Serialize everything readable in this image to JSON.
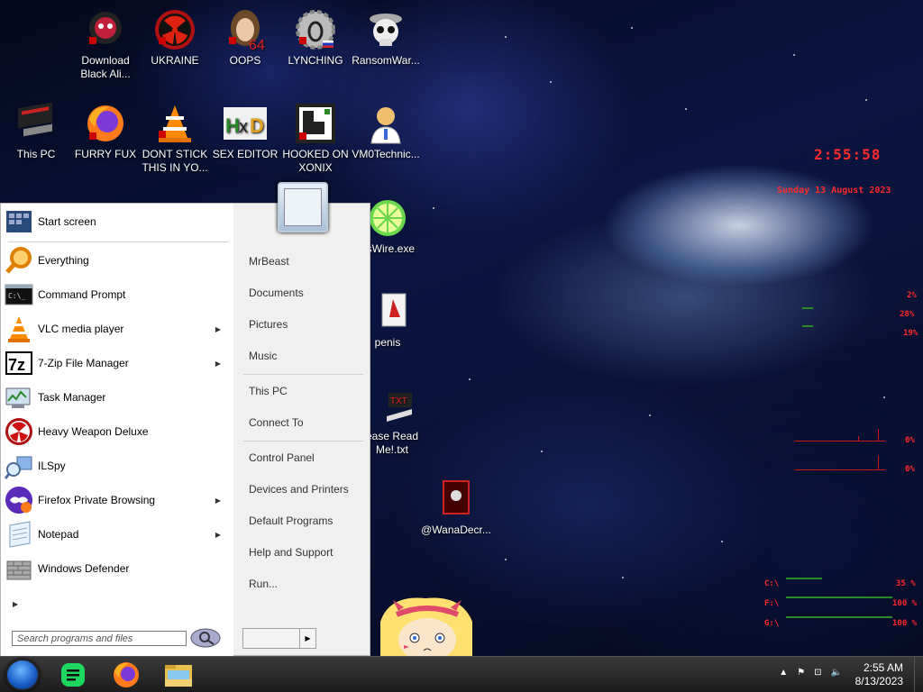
{
  "desktop": {
    "icons": [
      {
        "label": "Download Black Ali...",
        "name": "download-black-ali-icon"
      },
      {
        "label": "UKRAINE",
        "name": "ukraine-icon"
      },
      {
        "label": "OOPS",
        "name": "oops-icon"
      },
      {
        "label": "LYNCHING",
        "name": "lynching-icon"
      },
      {
        "label": "RansomWar...",
        "name": "ransomware-icon"
      },
      {
        "label": "This PC",
        "name": "this-pc-icon"
      },
      {
        "label": "FURRY FUX",
        "name": "furry-fux-icon"
      },
      {
        "label": "DONT STICK THIS IN YO...",
        "name": "dont-stick-icon"
      },
      {
        "label": "SEX EDITOR",
        "name": "sex-editor-icon"
      },
      {
        "label": "HOOKED ON XONIX",
        "name": "hooked-on-xonix-icon"
      },
      {
        "label": "VM0Technic...",
        "name": "vm0technic-icon"
      },
      {
        "label": "usWire.exe",
        "name": "limewire-icon"
      },
      {
        "label": "penis",
        "name": "penis-file-icon"
      },
      {
        "label": "ease Read Me!.txt",
        "name": "readme-txt-icon"
      },
      {
        "label": "@WanaDecr...",
        "name": "wanadecryptor-icon"
      }
    ]
  },
  "widgets": {
    "clock": "2:55:58",
    "date": "Sunday 13 August 2023",
    "cpu": [
      "2%",
      "28%",
      "19%"
    ],
    "net": [
      "0%",
      "0%"
    ],
    "drives": [
      {
        "label": "C:\\",
        "value": "35 %"
      },
      {
        "label": "F:\\",
        "value": "100 %"
      },
      {
        "label": "G:\\",
        "value": "100 %"
      }
    ]
  },
  "start_menu": {
    "pinned": [
      {
        "label": "Start screen",
        "icon": "start-screen-icon"
      }
    ],
    "programs": [
      {
        "label": "Everything",
        "icon": "magnifier-icon",
        "submenu": false
      },
      {
        "label": "Command Prompt",
        "icon": "cmd-icon",
        "submenu": false
      },
      {
        "label": "VLC media player",
        "icon": "vlc-cone-icon",
        "submenu": true
      },
      {
        "label": "7-Zip File Manager",
        "icon": "7zip-icon",
        "submenu": true
      },
      {
        "label": "Task Manager",
        "icon": "task-manager-icon",
        "submenu": false
      },
      {
        "label": "Heavy Weapon Deluxe",
        "icon": "radiation-icon",
        "submenu": false
      },
      {
        "label": "ILSpy",
        "icon": "ilspy-icon",
        "submenu": false
      },
      {
        "label": "Firefox Private Browsing",
        "icon": "firefox-private-icon",
        "submenu": true
      },
      {
        "label": "Notepad",
        "icon": "notepad-icon",
        "submenu": true
      },
      {
        "label": "Windows Defender",
        "icon": "defender-wall-icon",
        "submenu": false
      }
    ],
    "search_placeholder": "Search programs and files",
    "right": {
      "group1": [
        "MrBeast",
        "Documents",
        "Pictures",
        "Music"
      ],
      "group2": [
        "This PC",
        "Connect To"
      ],
      "group3": [
        "Control Panel",
        "Devices and Printers",
        "Default Programs",
        "Help and Support",
        "Run..."
      ]
    }
  },
  "taskbar": {
    "time": "2:55 AM",
    "date": "8/13/2023",
    "apps": [
      "spotify-icon",
      "firefox-icon",
      "file-explorer-icon"
    ]
  },
  "colors": {
    "widget_red": "#ff2a2a",
    "taskbar": "#1c1c1c",
    "menu_bg": "#f0f0f0"
  }
}
